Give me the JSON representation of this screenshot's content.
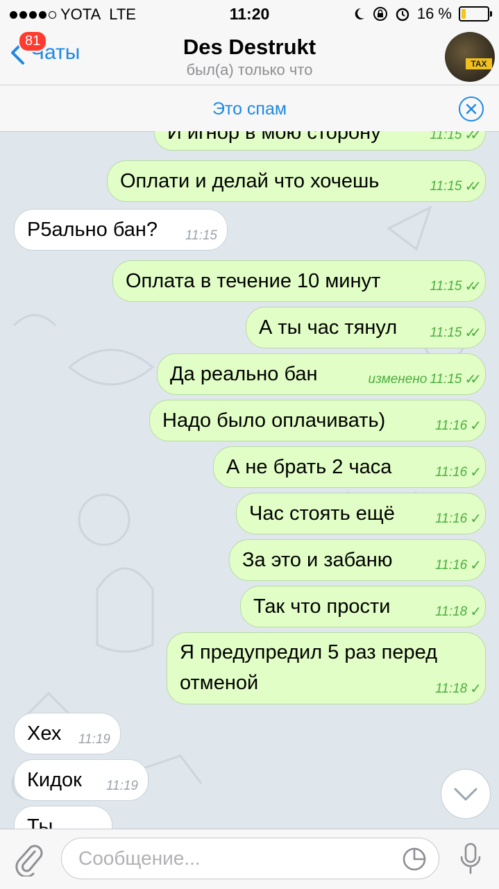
{
  "status": {
    "carrier": "YOTA",
    "network": "LTE",
    "time": "11:20",
    "battery_text": "16 %",
    "battery_level": 0.16,
    "battery_color": "#f5c518"
  },
  "nav": {
    "back_label": "Чаты",
    "unread_badge": "81",
    "title": "Des Destrukt",
    "subtitle": "был(а) только что",
    "avatar_text": "TAX"
  },
  "spam": {
    "label": "Это спам",
    "close_icon": "close-circle-icon"
  },
  "messages": [
    {
      "dir": "out",
      "text": "И игнор в мою сторону",
      "time": "11:15",
      "status": "read"
    },
    {
      "dir": "out",
      "text": "Оплати и делай что хочешь",
      "time": "11:15",
      "status": "read"
    },
    {
      "dir": "in",
      "text": "Р5ально бан?",
      "time": "11:15"
    },
    {
      "dir": "out",
      "text": "Оплата в течение 10 минут",
      "time": "11:15",
      "status": "read"
    },
    {
      "dir": "out",
      "text": "А ты час тянул",
      "time": "11:15",
      "status": "read"
    },
    {
      "dir": "out",
      "text": "Да реально бан",
      "edited": "изменено",
      "time": "11:15",
      "status": "read"
    },
    {
      "dir": "out",
      "text": "Надо было оплачивать)",
      "time": "11:16",
      "status": "sent"
    },
    {
      "dir": "out",
      "text": "А не брать 2 часа",
      "time": "11:16",
      "status": "sent"
    },
    {
      "dir": "out",
      "text": "Час стоять ещё",
      "time": "11:16",
      "status": "sent"
    },
    {
      "dir": "out",
      "text": "За это и забаню",
      "time": "11:16",
      "status": "sent"
    },
    {
      "dir": "out",
      "text": "Так что прости",
      "time": "11:18",
      "status": "sent"
    },
    {
      "dir": "out",
      "line1": "Я предупредил 5 раз перед",
      "line2": "отменой",
      "time": "11:18",
      "status": "sent"
    },
    {
      "dir": "in",
      "text": "Хех",
      "time": "11:19"
    },
    {
      "dir": "in",
      "text": "Кидок",
      "time": "11:19"
    },
    {
      "dir": "in",
      "text": "Ты",
      "time": ""
    }
  ],
  "checks": {
    "read": "✓✓",
    "sent": "✓"
  },
  "input": {
    "placeholder": "Сообщение..."
  },
  "colors": {
    "accent": "#1e88e5",
    "outgoing_bubble": "#e1fec6",
    "incoming_bubble": "#ffffff",
    "chat_background": "#dfe6ec",
    "badge": "#ff3b30"
  }
}
